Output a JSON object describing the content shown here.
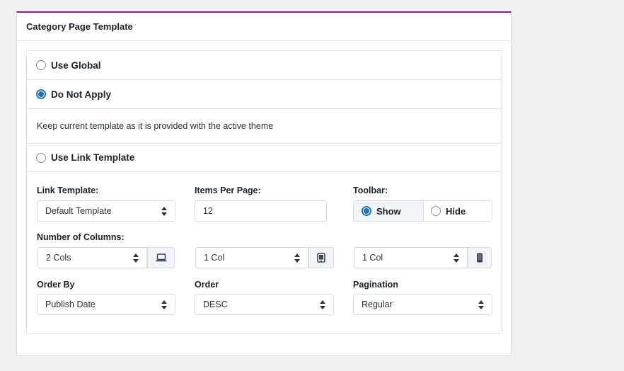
{
  "panel": {
    "title": "Category Page Template"
  },
  "options": [
    {
      "label": "Use Global",
      "checked": false
    },
    {
      "label": "Do Not Apply",
      "checked": true
    },
    {
      "label": "Use Link Template",
      "checked": false
    }
  ],
  "description": "Keep current template as it is provided with the active theme",
  "fields": {
    "link_template": {
      "label": "Link Template:",
      "value": "Default Template"
    },
    "items_per_page": {
      "label": "Items Per Page:",
      "value": "12"
    },
    "toolbar": {
      "label": "Toolbar:",
      "options": [
        "Show",
        "Hide"
      ],
      "selected": "Show"
    },
    "columns": {
      "label": "Number of Columns:",
      "desktop": {
        "value": "2 Cols",
        "icon": "laptop-icon"
      },
      "tablet": {
        "value": "1 Col",
        "icon": "tablet-icon"
      },
      "mobile": {
        "value": "1 Col",
        "icon": "mobile-icon"
      }
    },
    "order_by": {
      "label": "Order By",
      "value": "Publish Date"
    },
    "order": {
      "label": "Order",
      "value": "DESC"
    },
    "pagination": {
      "label": "Pagination",
      "value": "Regular"
    }
  },
  "colors": {
    "accent_border": "#8c1a7f",
    "radio_checked": "#2271b1"
  }
}
